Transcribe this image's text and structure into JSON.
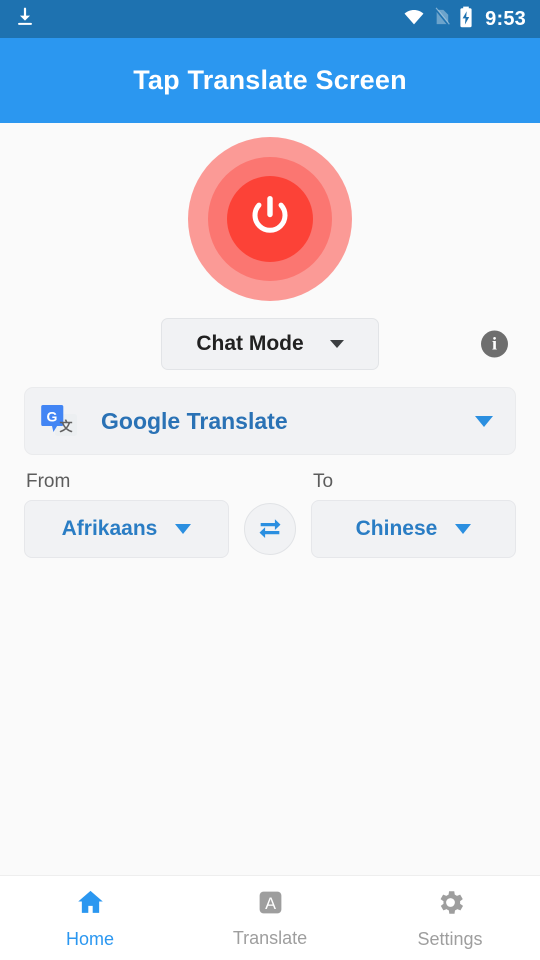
{
  "status_bar": {
    "download_icon": "download-icon",
    "wifi_icon": "wifi-icon",
    "sim_icon": "sim-card-off-icon",
    "battery_icon": "battery-charging-icon",
    "time": "9:53",
    "background_color": "#1e72b0"
  },
  "app_bar": {
    "title": "Tap Translate Screen",
    "background_color": "#2b97f0"
  },
  "power_button": {
    "name": "power-toggle-button",
    "icon": "power-icon",
    "outer_color": "#fb9a96",
    "mid_color": "#fb7671",
    "core_color": "#fc4237"
  },
  "mode": {
    "selected": "Chat Mode",
    "caret_icon": "chevron-down-icon",
    "info_icon": "info-icon",
    "info_label": "i"
  },
  "engine": {
    "name": "Google Translate",
    "icon": "google-translate-icon",
    "caret_icon": "chevron-down-icon"
  },
  "languages": {
    "from_label": "From",
    "from_value": "Afrikaans",
    "to_label": "To",
    "to_value": "Chinese",
    "swap_icon": "swap-horizontal-icon",
    "caret_icon": "chevron-down-icon"
  },
  "bottom_nav": {
    "active_color": "#2b97f0",
    "inactive_color": "#9e9e9e",
    "items": [
      {
        "label": "Home",
        "icon": "home-icon",
        "active": true
      },
      {
        "label": "Translate",
        "icon": "translate-a-icon",
        "active": false
      },
      {
        "label": "Settings",
        "icon": "gear-icon",
        "active": false
      }
    ]
  }
}
